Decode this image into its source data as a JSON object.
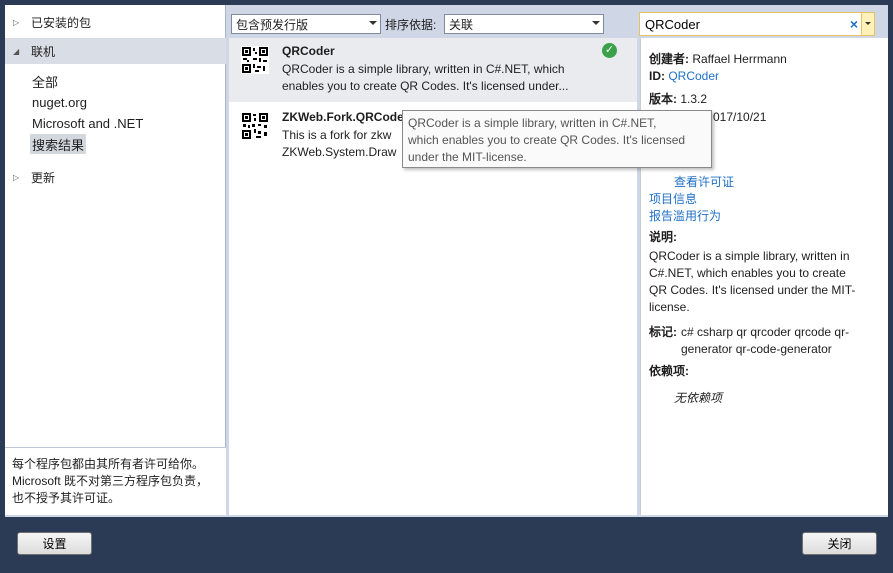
{
  "sidebar": {
    "installed": "已安装的包",
    "online": "联机",
    "online_items": [
      "全部",
      "nuget.org",
      "Microsoft and .NET",
      "搜索结果"
    ],
    "updates": "更新",
    "disclaimer_lines": [
      "每个程序包都由其所有者许可给你。",
      "Microsoft 既不对第三方程序包负责，",
      "也不授予其许可证。"
    ]
  },
  "toolbar": {
    "filter_value": "包含预发行版",
    "sort_label": "排序依据:",
    "sort_value": "关联",
    "search_value": "QRCoder",
    "clear_icon": "×"
  },
  "packages": [
    {
      "title": "QRCoder",
      "desc_line1": "QRCoder is a simple library, written in C#.NET, which",
      "desc_line2": "enables you to create QR Codes. It's licensed under...",
      "installed_check": "✓"
    },
    {
      "title": "ZKWeb.Fork.QRCoder",
      "desc_line1": "This is a fork for zkw",
      "desc_line2": "ZKWeb.System.Draw"
    }
  ],
  "tooltip": {
    "line1": "QRCoder is a simple library, written in C#.NET,",
    "line2": "which enables you to create QR Codes. It's licensed",
    "line3": "under the MIT-license."
  },
  "details": {
    "creator_label": "创建者:",
    "creator_value": "Raffael Herrmann",
    "id_label": "ID:",
    "id_value": "QRCoder",
    "version_label": "版本:",
    "version_value": "1.3.2",
    "date_partial": "017/10/21",
    "view_license": "查看许可证",
    "project_info": "项目信息",
    "report_abuse": "报告滥用行为",
    "desc_label": "说明:",
    "desc_lines": [
      "QRCoder is a simple library, written in",
      "C#.NET, which enables you to create",
      "QR Codes. It's licensed under the MIT-",
      "license."
    ],
    "tags_label": "标记:",
    "tags_line1": "c# csharp qr qrcoder qrcode qr-",
    "tags_line2": "generator qr-code-generator",
    "deps_label": "依赖项:",
    "deps_value": "无依赖项"
  },
  "buttons": {
    "settings": "设置",
    "close": "关闭"
  }
}
